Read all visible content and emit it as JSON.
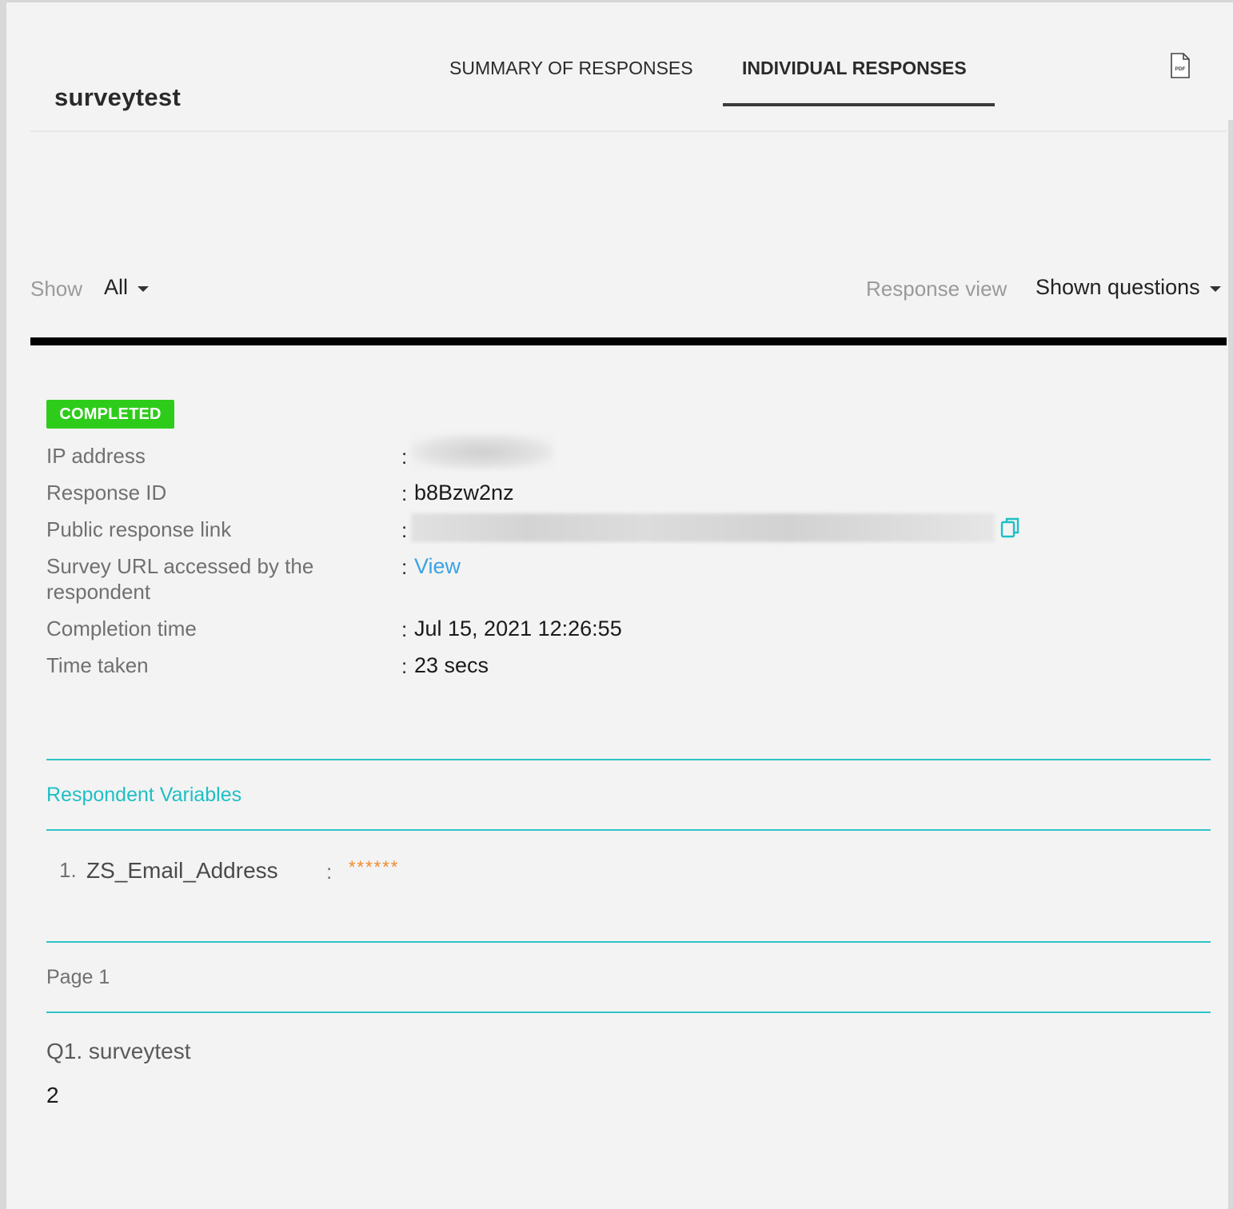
{
  "header": {
    "title": "surveytest",
    "tabs": [
      {
        "label": "SUMMARY OF RESPONSES",
        "active": false
      },
      {
        "label": "INDIVIDUAL RESPONSES",
        "active": true
      }
    ],
    "pdf_icon_text": "PDF"
  },
  "filters": {
    "show_label": "Show",
    "show_value": "All",
    "response_view_label": "Response view",
    "response_view_value": "Shown questions"
  },
  "response": {
    "status": "COMPLETED",
    "status_color": "#2ecc1a",
    "fields": [
      {
        "label": "IP address",
        "value": ""
      },
      {
        "label": "Response ID",
        "value": "b8Bzw2nz"
      },
      {
        "label": "Public response link",
        "value": ""
      },
      {
        "label": "Survey URL accessed by the respondent",
        "value": "View"
      },
      {
        "label": "Completion time",
        "value": "Jul 15, 2021 12:26:55"
      },
      {
        "label": "Time taken",
        "value": "23 secs"
      }
    ],
    "colon": ":"
  },
  "respondent_variables": {
    "title": "Respondent Variables",
    "items": [
      {
        "index": "1.",
        "name": "ZS_Email_Address",
        "separator": ":",
        "value": "******"
      }
    ]
  },
  "page": {
    "label": "Page 1",
    "questions": [
      {
        "question": "Q1. surveytest",
        "answer": "2"
      }
    ]
  },
  "colors": {
    "accent": "#2ec4c6",
    "link": "#3aa3e3",
    "masked_value": "#f08a2a"
  }
}
